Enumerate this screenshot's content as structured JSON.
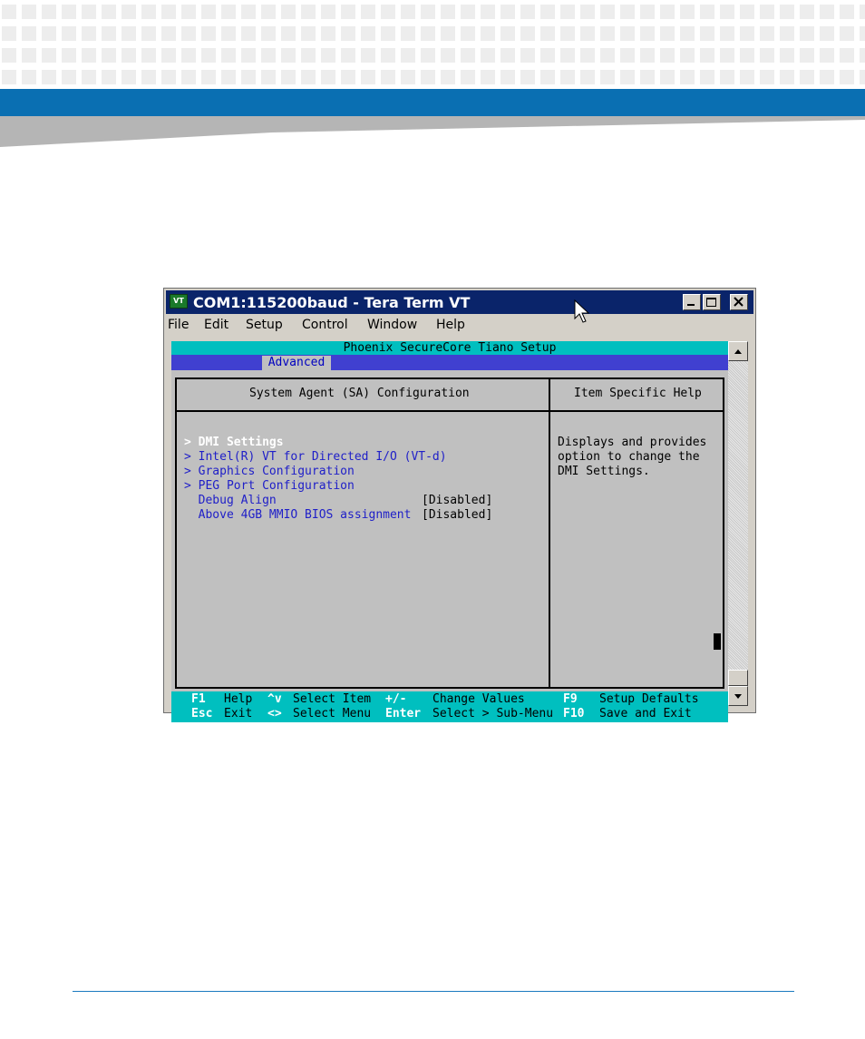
{
  "window": {
    "title": "COM1:115200baud - Tera Term VT",
    "icon_label": "VT"
  },
  "menu": [
    "File",
    "Edit",
    "Setup",
    "Control",
    "Window",
    "Help"
  ],
  "bios": {
    "title": "Phoenix SecureCore Tiano Setup",
    "tab": "Advanced",
    "section_title": "System Agent (SA) Configuration",
    "help_title": "Item Specific Help",
    "items": [
      {
        "label": "> DMI Settings",
        "value": ""
      },
      {
        "label": "> Intel(R) VT for Directed I/O (VT-d)",
        "value": ""
      },
      {
        "label": "> Graphics Configuration",
        "value": ""
      },
      {
        "label": "> PEG Port Configuration",
        "value": ""
      },
      {
        "label": "  Debug Align",
        "value": "[Disabled]"
      },
      {
        "label": "  Above 4GB MMIO BIOS assignment",
        "value": "[Disabled]"
      }
    ],
    "help_text": [
      "Displays and provides",
      "option to change the",
      "DMI Settings."
    ],
    "footer": {
      "row1": [
        {
          "key": "F1",
          "text": "Help"
        },
        {
          "key": "^v",
          "text": "Select Item"
        },
        {
          "key": "+/-",
          "text": "Change Values"
        },
        {
          "key": "F9",
          "text": "Setup Defaults"
        }
      ],
      "row2": [
        {
          "key": "Esc",
          "text": "Exit"
        },
        {
          "key": "<>",
          "text": "Select Menu"
        },
        {
          "key": "Enter",
          "text": "Select > Sub-Menu"
        },
        {
          "key": "F10",
          "text": "Save and Exit"
        }
      ]
    }
  },
  "colors": {
    "accent_blue": "#0a6fb2",
    "terminal_cyan": "#00bfbf",
    "menu_blue": "#4040d0",
    "item_text": "#2020c8"
  }
}
